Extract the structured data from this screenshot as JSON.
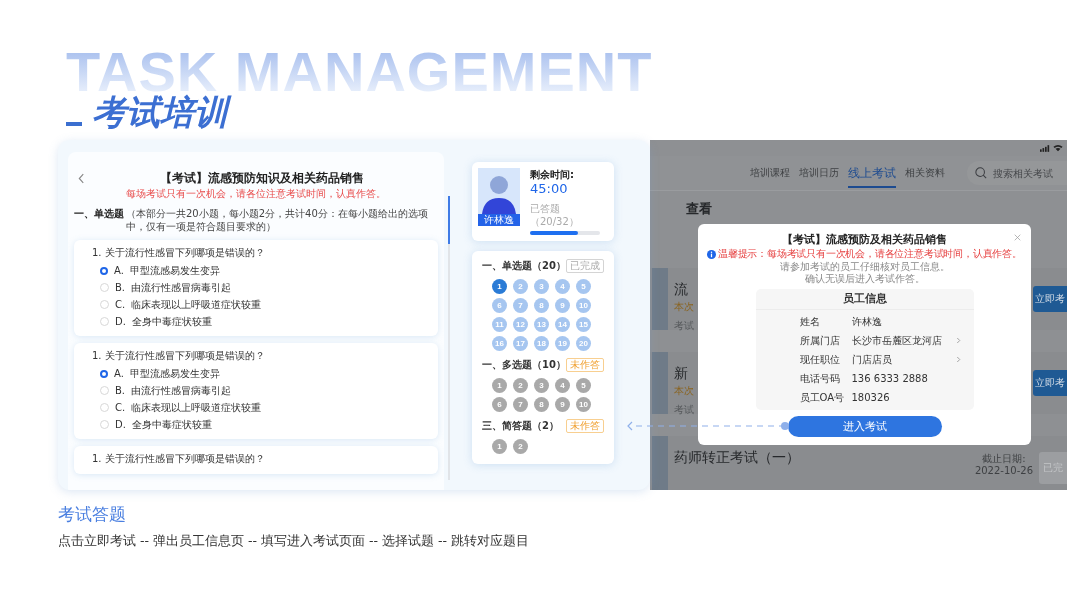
{
  "header": {
    "watermark": "TASK MANAGEMENT",
    "title": "考试培训"
  },
  "exam": {
    "title": "【考试】流感预防知识及相关药品销售",
    "notice": "每场考试只有一次机会，请各位注意考试时间，认真作答。",
    "section_title": "一、单选题",
    "section_note": "（本部分一共20小题，每小题2分，共计40分：在每小题给出的选项中，仅有一项是符合题目要求的）",
    "questions": [
      {
        "text": "1. 关于流行性感冒下列哪项是错误的？",
        "options": [
          {
            "letter": "A.",
            "text": "甲型流感易发生变异",
            "selected": true
          },
          {
            "letter": "B.",
            "text": "由流行性感冒病毒引起",
            "selected": false
          },
          {
            "letter": "C.",
            "text": "临床表现以上呼吸道症状较重",
            "selected": false
          },
          {
            "letter": "D.",
            "text": "全身中毒症状较重",
            "selected": false
          }
        ]
      },
      {
        "text": "1. 关于流行性感冒下列哪项是错误的？",
        "options": [
          {
            "letter": "A.",
            "text": "甲型流感易发生变异",
            "selected": true
          },
          {
            "letter": "B.",
            "text": "由流行性感冒病毒引起",
            "selected": false
          },
          {
            "letter": "C.",
            "text": "临床表现以上呼吸道症状较重",
            "selected": false
          },
          {
            "letter": "D.",
            "text": "全身中毒症状较重",
            "selected": false
          }
        ]
      },
      {
        "text": "1. 关于流行性感冒下列哪项是错误的？"
      }
    ]
  },
  "candidate": {
    "name": "许林逸",
    "time_label": "剩余时间:",
    "time": "45:00",
    "progress_label": "已答题（20/32）",
    "level": 0.69
  },
  "navigator": [
    {
      "title": "一、单选题（20）",
      "status": "已完成",
      "done": true,
      "numbers": [
        {
          "label": "1",
          "kind": "current"
        },
        {
          "label": "2",
          "kind": "answered"
        },
        {
          "label": "3",
          "kind": "answered"
        },
        {
          "label": "4",
          "kind": "answered"
        },
        {
          "label": "5",
          "kind": "answered"
        },
        {
          "label": "6",
          "kind": "answered"
        },
        {
          "label": "7",
          "kind": "answered"
        },
        {
          "label": "8",
          "kind": "answered"
        },
        {
          "label": "9",
          "kind": "answered"
        },
        {
          "label": "10",
          "kind": "answered"
        },
        {
          "label": "11",
          "kind": "answered"
        },
        {
          "label": "12",
          "kind": "answered"
        },
        {
          "label": "13",
          "kind": "answered"
        },
        {
          "label": "14",
          "kind": "answered"
        },
        {
          "label": "15",
          "kind": "answered"
        },
        {
          "label": "16",
          "kind": "answered"
        },
        {
          "label": "17",
          "kind": "answered"
        },
        {
          "label": "18",
          "kind": "answered"
        },
        {
          "label": "19",
          "kind": "answered"
        },
        {
          "label": "20",
          "kind": "answered"
        }
      ]
    },
    {
      "title": "一、多选题（10）",
      "status": "未作答",
      "done": false,
      "numbers": [
        {
          "label": "1",
          "kind": "unanswered"
        },
        {
          "label": "2",
          "kind": "unanswered"
        },
        {
          "label": "3",
          "kind": "unanswered"
        },
        {
          "label": "4",
          "kind": "unanswered"
        },
        {
          "label": "5",
          "kind": "unanswered"
        },
        {
          "label": "6",
          "kind": "unanswered"
        },
        {
          "label": "7",
          "kind": "unanswered"
        },
        {
          "label": "8",
          "kind": "unanswered"
        },
        {
          "label": "9",
          "kind": "unanswered"
        },
        {
          "label": "10",
          "kind": "unanswered"
        }
      ]
    },
    {
      "title": "三、简答题（2）",
      "status": "未作答",
      "done": false,
      "numbers": [
        {
          "label": "1",
          "kind": "unanswered"
        },
        {
          "label": "2",
          "kind": "unanswered"
        }
      ]
    }
  ],
  "app": {
    "tabs": [
      {
        "label": "培训课程",
        "selected": false
      },
      {
        "label": "培训日历",
        "selected": false
      },
      {
        "label": "线上考试",
        "selected": true
      },
      {
        "label": "相关资料",
        "selected": false
      }
    ],
    "search_placeholder": "搜索相关考试",
    "heading": "查看",
    "exams": [
      {
        "title": "流",
        "note": "本次",
        "meta": "考试",
        "button": "立即考",
        "done": false
      },
      {
        "title": "新",
        "note": "本次",
        "meta": "考试",
        "button": "立即考",
        "done": false
      },
      {
        "title": "药师转正考试（一）",
        "deadline_label": "截止日期:",
        "deadline": "2022-10-26",
        "button": "已完",
        "done": true
      }
    ]
  },
  "modal": {
    "title": "【考试】流感预防及相关药品销售",
    "tip": "温馨提示：每场考试只有一次机会，请各位注意考试时间，认真作答。",
    "instructions": [
      "请参加考试的员工仔细核对员工信息。",
      "确认无误后进入考试作答。"
    ],
    "info_title": "员工信息",
    "fields": [
      {
        "label": "姓名",
        "value": "许林逸",
        "link": false
      },
      {
        "label": "所属门店",
        "value": "长沙市岳麓区龙河店",
        "link": true
      },
      {
        "label": "现任职位",
        "value": "门店店员",
        "link": true
      },
      {
        "label": "电话号码",
        "value": "136 6333 2888",
        "link": false
      },
      {
        "label": "员工OA号",
        "value": "180326",
        "link": false
      }
    ],
    "button": "进入考试"
  },
  "caption": {
    "title": "考试答题",
    "description": "点击立即考试 -- 弹出员工信息页 -- 填写进入考试页面 -- 选择试题 -- 跳转对应题目"
  }
}
